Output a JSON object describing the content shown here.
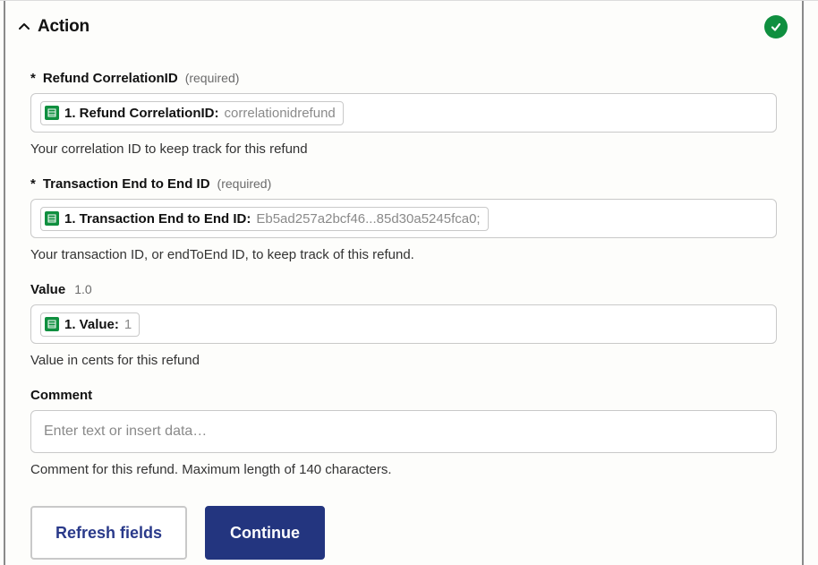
{
  "header": {
    "title": "Action"
  },
  "fields": {
    "refund_correlation_id": {
      "label": "Refund CorrelationID",
      "required_text": "required",
      "pill_key": "1. Refund CorrelationID:",
      "pill_val": "correlationidrefund",
      "help": "Your correlation ID to keep track for this refund"
    },
    "transaction_id": {
      "label": "Transaction End to End ID",
      "required_text": "required",
      "pill_key": "1. Transaction End to End ID:",
      "pill_val": "Eb5ad257a2bcf46...85d30a5245fca0;",
      "help": "Your transaction ID, or endToEnd ID, to keep track of this refund."
    },
    "value": {
      "label": "Value",
      "hint": "1.0",
      "pill_key": "1. Value:",
      "pill_val": "1",
      "help": "Value in cents for this refund"
    },
    "comment": {
      "label": "Comment",
      "placeholder": "Enter text or insert data…",
      "help": "Comment for this refund. Maximum length of 140 characters."
    }
  },
  "buttons": {
    "refresh": "Refresh fields",
    "continue": "Continue"
  }
}
